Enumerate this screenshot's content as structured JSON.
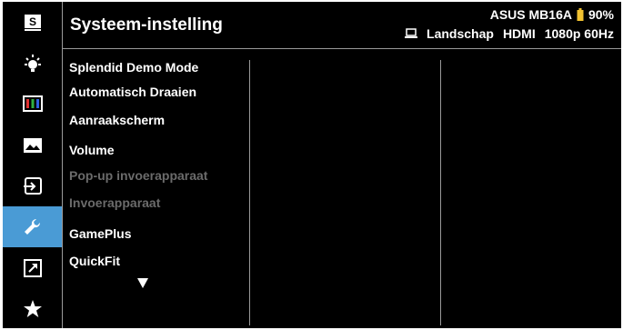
{
  "header": {
    "title": "Systeem-instelling",
    "model": "ASUS MB16A",
    "battery": "90%",
    "orientation": "Landschap",
    "input": "HDMI",
    "resolution": "1080p 60Hz"
  },
  "sidebar": {
    "items": [
      {
        "icon": "splendid-icon"
      },
      {
        "icon": "blue-light-filter-icon"
      },
      {
        "icon": "color-icon"
      },
      {
        "icon": "image-icon"
      },
      {
        "icon": "input-select-icon"
      },
      {
        "icon": "system-setup-wrench-icon",
        "active": true
      },
      {
        "icon": "shortcut-icon"
      },
      {
        "icon": "my-favorite-star-icon"
      }
    ]
  },
  "menu": {
    "items": [
      {
        "label": "Splendid Demo Mode",
        "enabled": true
      },
      {
        "label": "Automatisch Draaien",
        "enabled": true
      },
      {
        "label": "Aanraakscherm",
        "enabled": true
      },
      {
        "label": "Volume",
        "enabled": true
      },
      {
        "label": "Pop-up invoerapparaat",
        "enabled": false
      },
      {
        "label": "Invoerapparaat",
        "enabled": false
      },
      {
        "label": "GamePlus",
        "enabled": true
      },
      {
        "label": "QuickFit",
        "enabled": true
      }
    ]
  },
  "colors": {
    "background": "#000000",
    "active": "#4a9bd5",
    "battery": "#f2c230",
    "disabled": "#6b6b6b"
  }
}
